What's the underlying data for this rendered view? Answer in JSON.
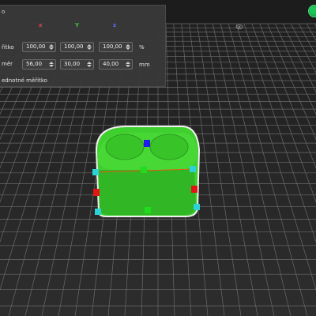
{
  "panel": {
    "title": "o",
    "axes": {
      "x": "x",
      "y": "Y",
      "z": "z"
    },
    "scale_label": "řítko",
    "size_label": "měr",
    "scale_values": [
      "100,00",
      "100,00",
      "100,00"
    ],
    "scale_unit": "%",
    "size_values": [
      "56,00",
      "30,00",
      "40,00"
    ],
    "size_unit": "mm",
    "uniform_scale_label": "ednotné měřítko"
  },
  "colors": {
    "background": "#2b2b2b",
    "grid": "#6a6a6a",
    "bed_horizon": "#3a3a3a",
    "model_green": "#3fcf2e",
    "model_outline": "#f0f0f0",
    "handle_cyan": "#2bd3d8",
    "handle_red": "#e01515",
    "handle_green": "#1fdc1f",
    "handle_blue": "#1e1ee6",
    "status_green": "#20c55a"
  },
  "icons": {
    "spin_up": "chevron-up-icon",
    "spin_down": "chevron-down-icon"
  }
}
